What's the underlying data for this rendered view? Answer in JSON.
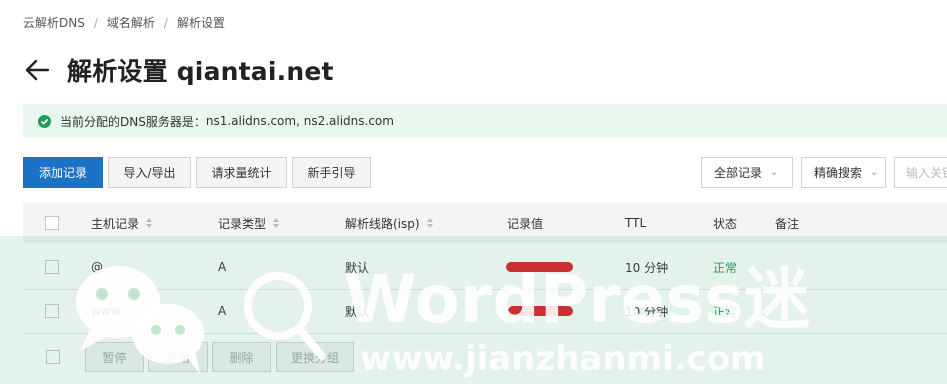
{
  "breadcrumb": [
    "云解析DNS",
    "域名解析",
    "解析设置"
  ],
  "page": {
    "title": "解析设置 qiantai.net"
  },
  "notice": {
    "label": "当前分配的DNS服务器是：",
    "servers": "ns1.alidns.com, ns2.alidns.com"
  },
  "toolbar": {
    "add_record": "添加记录",
    "import_export": "导入/导出",
    "request_stats": "请求量统计",
    "guide": "新手引导",
    "filter_all": "全部记录",
    "precise_search": "精确搜索",
    "search_placeholder": "输入关键字"
  },
  "table": {
    "headers": {
      "host": "主机记录",
      "type": "记录类型",
      "line": "解析线路(isp)",
      "value": "记录值",
      "ttl": "TTL",
      "status": "状态",
      "remark": "备注"
    },
    "rows": [
      {
        "host": "@",
        "type": "A",
        "line": "默认",
        "ttl": "10 分钟",
        "status": "正常"
      },
      {
        "host": "www",
        "type": "A",
        "line": "默认",
        "ttl": "10 分钟",
        "status": "正常"
      }
    ]
  },
  "footer": {
    "pause": "暂停",
    "enable": "启用",
    "delete": "删除",
    "change_group": "更换分组"
  },
  "watermark": {
    "brand": "WordPress迷",
    "url": "www.jianzhanmi.com"
  },
  "colors": {
    "primary": "#1a73c6",
    "success": "#1f9d55",
    "redact": "#e0202c",
    "watermark": "#28a564"
  }
}
